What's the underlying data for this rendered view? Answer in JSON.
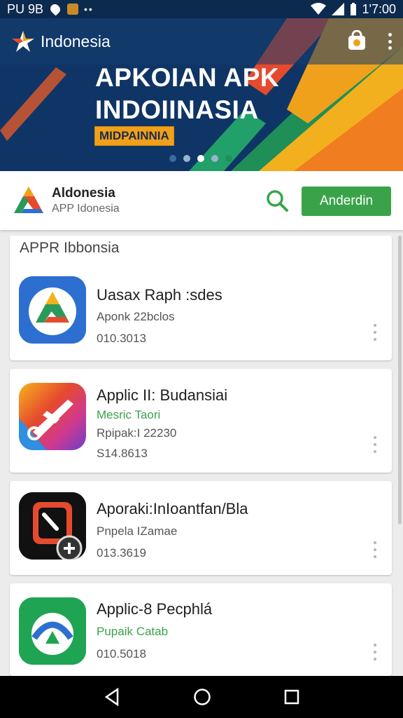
{
  "status_bar": {
    "left_text": "PU 9B",
    "right_text": "1'7:00",
    "icons": [
      "heart-icon",
      "app-notification-icon",
      "more-dots-icon",
      "wifi-icon",
      "signal-icon",
      "battery-icon"
    ]
  },
  "banner": {
    "brand_title": "Indonesia",
    "headline_line1": "APKOIAN APK",
    "headline_line2": "INDOIINASIA",
    "tag": "MIDPAINNIA",
    "page_indicator": {
      "count": 5,
      "active": 2
    },
    "colors": {
      "navy": "#0f3566",
      "orange": "#f0a11c",
      "red": "#e64a2e",
      "green": "#2a9a5b"
    }
  },
  "app_header": {
    "name": "Aldonesia",
    "subtitle": "APP Idonesia",
    "button_label": "Anderdin",
    "accent": "#3aa34a"
  },
  "list": {
    "section_title": "APPR Ibbonsia",
    "items": [
      {
        "title": "Uasax Raph  :sdes",
        "green_line": "",
        "line1": "Aponk 22bclos",
        "line2": "010.3013",
        "icon": "google-drive-like-icon"
      },
      {
        "title": "Applic II: Budansiai",
        "green_line": "Mesric Taori",
        "line1": "Rpipak:I 22230",
        "line2": "S14.8613",
        "icon": "airplane-satellite-icon"
      },
      {
        "title": "Aporaki:InIoantfan/Bla",
        "green_line": "",
        "line1": "Pnpela IZamae",
        "line2": "013.3619",
        "icon": "clock-add-icon"
      },
      {
        "title": "Applic-8 Pecphlá",
        "green_line": "Pupaik Catab",
        "line1": "",
        "line2": "010.5018",
        "icon": "cloud-arrow-icon"
      }
    ]
  },
  "nav_bar": {
    "icons": [
      "back-icon",
      "home-icon",
      "recents-icon"
    ]
  }
}
